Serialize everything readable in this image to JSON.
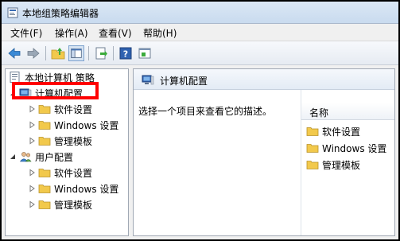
{
  "window": {
    "title": "本地组策略编辑器"
  },
  "menu": {
    "items": [
      "文件(F)",
      "操作(A)",
      "查看(V)",
      "帮助(H)"
    ]
  },
  "toolbar": {
    "icons": [
      "back-arrow-icon",
      "forward-arrow-icon",
      "up-folder-icon",
      "show-hide-tree-icon",
      "export-list-icon",
      "help-icon",
      "properties-icon"
    ]
  },
  "tree": {
    "root_label": "本地计算机 策略",
    "computer_config": {
      "label": "计算机配置",
      "children": [
        "软件设置",
        "Windows 设置",
        "管理模板"
      ]
    },
    "user_config": {
      "label": "用户配置",
      "children": [
        "软件设置",
        "Windows 设置",
        "管理模板"
      ]
    }
  },
  "right_pane": {
    "header_title": "计算机配置",
    "description": "选择一个项目来查看它的描述。",
    "column_header": "名称",
    "items": [
      "软件设置",
      "Windows 设置",
      "管理模板"
    ]
  },
  "colors": {
    "highlight_border": "#ff0000",
    "folder_yellow": "#f2c94c"
  }
}
